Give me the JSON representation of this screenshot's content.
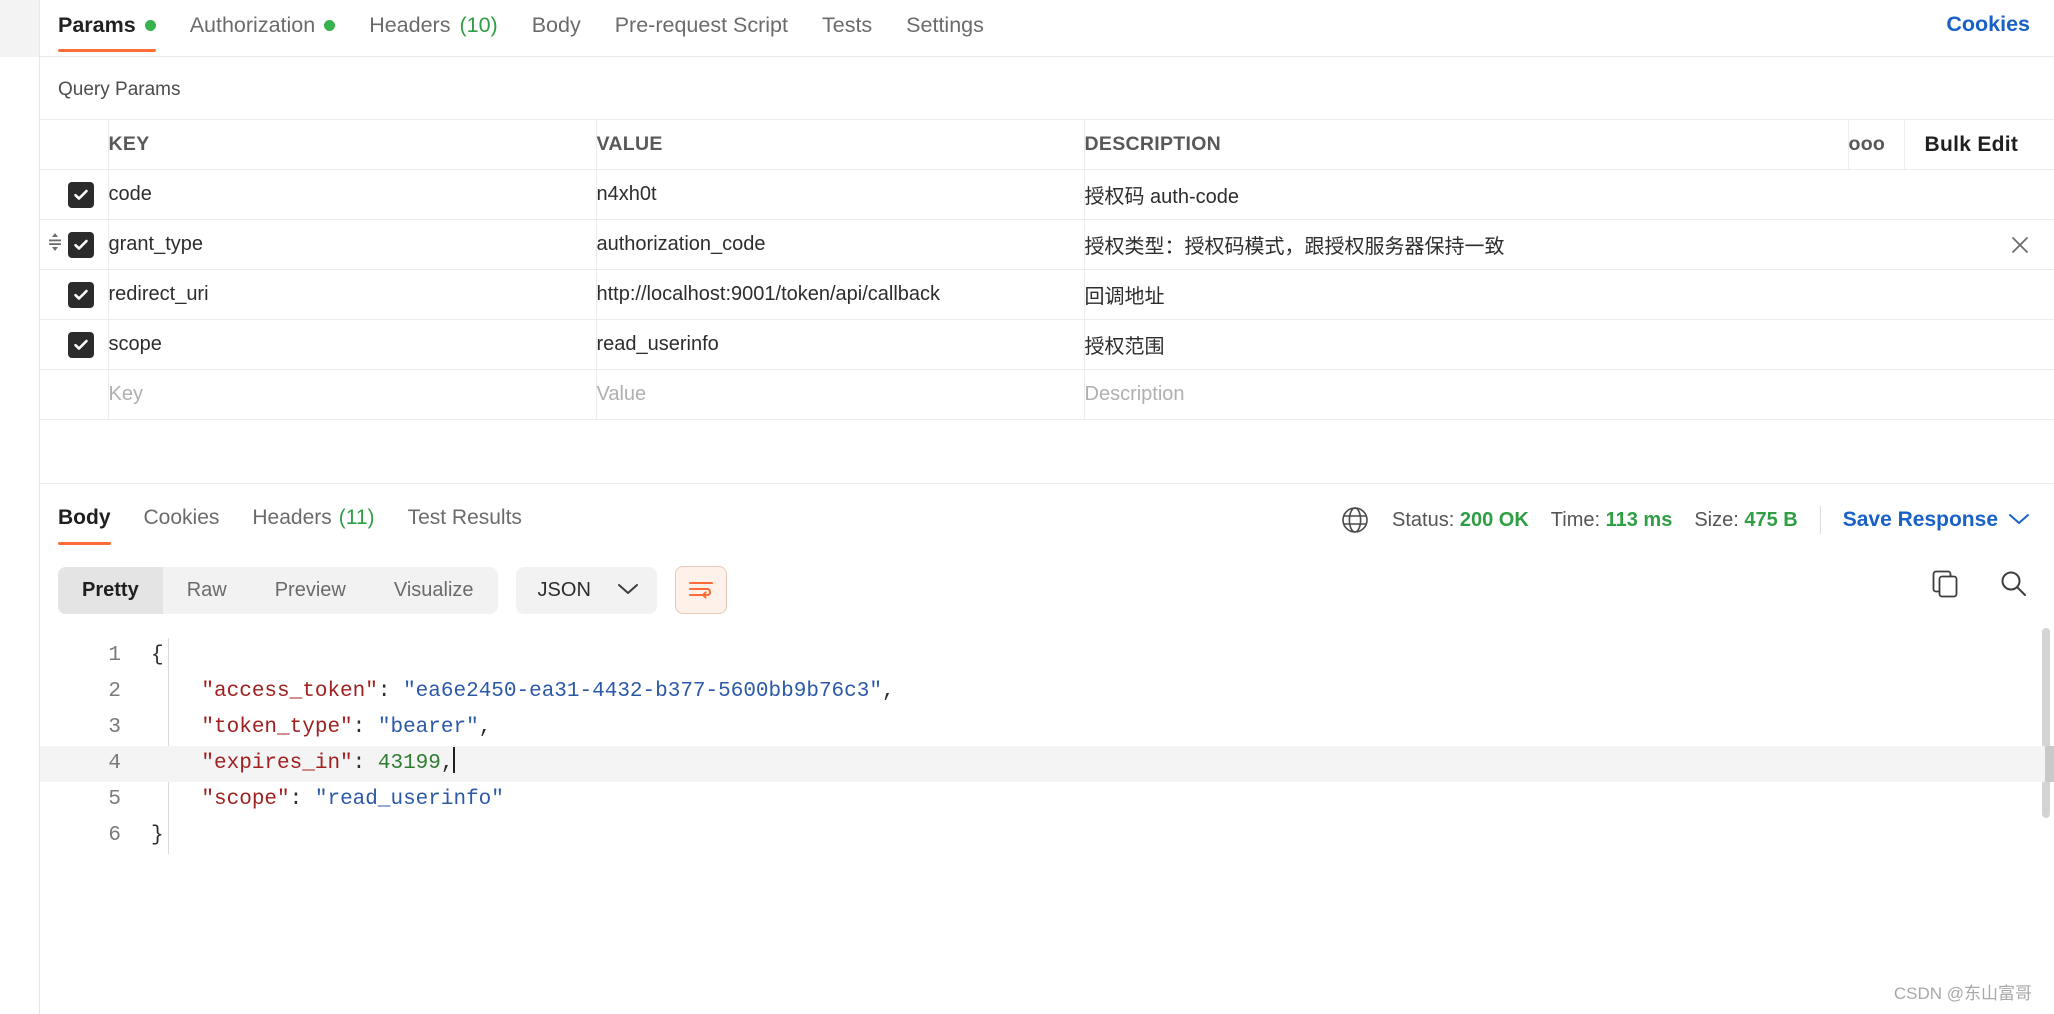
{
  "request_tabs": [
    {
      "label": "Params",
      "dot": true,
      "active": true
    },
    {
      "label": "Authorization",
      "dot": true,
      "active": false
    },
    {
      "label": "Headers",
      "count": "(10)",
      "active": false
    },
    {
      "label": "Body",
      "active": false
    },
    {
      "label": "Pre-request Script",
      "active": false
    },
    {
      "label": "Tests",
      "active": false
    },
    {
      "label": "Settings",
      "active": false
    }
  ],
  "cookies_link": "Cookies",
  "query_params": {
    "section_title": "Query Params",
    "columns": [
      "KEY",
      "VALUE",
      "DESCRIPTION"
    ],
    "bulk_edit_label": "Bulk Edit",
    "options_icon": "ooo",
    "rows": [
      {
        "checked": true,
        "key": "code",
        "value": "n4xh0t",
        "description": "授权码 auth-code"
      },
      {
        "checked": true,
        "key": "grant_type",
        "value": "authorization_code",
        "description": "授权类型：授权码模式，跟授权服务器保持一致",
        "active": true
      },
      {
        "checked": true,
        "key": "redirect_uri",
        "value": "http://localhost:9001/token/api/callback",
        "description": "回调地址"
      },
      {
        "checked": true,
        "key": "scope",
        "value": "read_userinfo",
        "description": "授权范围"
      }
    ],
    "empty_row": {
      "key_placeholder": "Key",
      "value_placeholder": "Value",
      "description_placeholder": "Description"
    }
  },
  "response": {
    "tabs": [
      {
        "label": "Body",
        "active": true
      },
      {
        "label": "Cookies",
        "active": false
      },
      {
        "label": "Headers",
        "count": "(11)",
        "active": false
      },
      {
        "label": "Test Results",
        "active": false
      }
    ],
    "status_label": "Status:",
    "status_value": "200 OK",
    "time_label": "Time:",
    "time_value": "113 ms",
    "size_label": "Size:",
    "size_value": "475 B",
    "save_response_label": "Save Response",
    "view_modes": [
      {
        "label": "Pretty",
        "active": true
      },
      {
        "label": "Raw",
        "active": false
      },
      {
        "label": "Preview",
        "active": false
      },
      {
        "label": "Visualize",
        "active": false
      }
    ],
    "format_selected": "JSON",
    "body_lines": [
      {
        "num": "1",
        "tokens": [
          {
            "t": "{",
            "c": "j-punc"
          }
        ]
      },
      {
        "num": "2",
        "indent": "    ",
        "tokens": [
          {
            "t": "\"access_token\"",
            "c": "j-key"
          },
          {
            "t": ": ",
            "c": "j-punc"
          },
          {
            "t": "\"ea6e2450-ea31-4432-b377-5600bb9b76c3\"",
            "c": "j-str"
          },
          {
            "t": ",",
            "c": "j-punc"
          }
        ]
      },
      {
        "num": "3",
        "indent": "    ",
        "tokens": [
          {
            "t": "\"token_type\"",
            "c": "j-key"
          },
          {
            "t": ": ",
            "c": "j-punc"
          },
          {
            "t": "\"bearer\"",
            "c": "j-str"
          },
          {
            "t": ",",
            "c": "j-punc"
          }
        ]
      },
      {
        "num": "4",
        "indent": "    ",
        "highlight": true,
        "caret": true,
        "tokens": [
          {
            "t": "\"expires_in\"",
            "c": "j-key"
          },
          {
            "t": ": ",
            "c": "j-punc"
          },
          {
            "t": "43199",
            "c": "j-num"
          },
          {
            "t": ",",
            "c": "j-punc"
          }
        ]
      },
      {
        "num": "5",
        "indent": "    ",
        "tokens": [
          {
            "t": "\"scope\"",
            "c": "j-key"
          },
          {
            "t": ": ",
            "c": "j-punc"
          },
          {
            "t": "\"read_userinfo\"",
            "c": "j-str"
          }
        ]
      },
      {
        "num": "6",
        "tokens": [
          {
            "t": "}",
            "c": "j-punc"
          }
        ]
      }
    ]
  },
  "watermark": "CSDN @东山富哥",
  "colors": {
    "accent": "#ff6c37",
    "link": "#1a61c7",
    "success": "#2f9e44",
    "checkbox": "#2b2b2b"
  }
}
